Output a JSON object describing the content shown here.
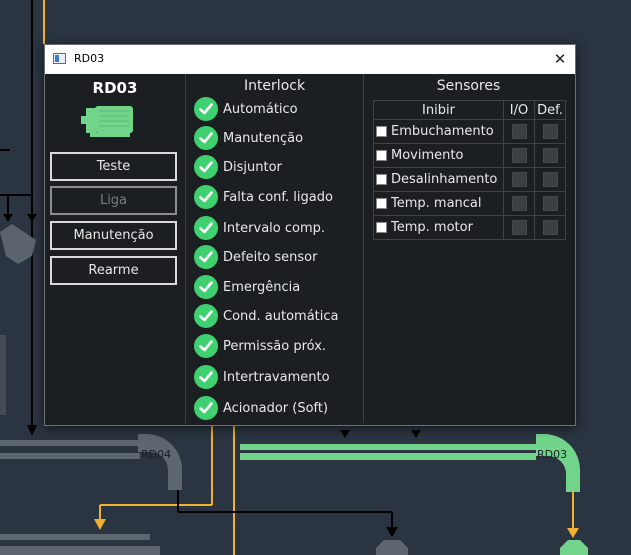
{
  "window": {
    "title": "RD03"
  },
  "device": {
    "name": "RD03",
    "motor_icon": "motor-icon",
    "motor_color": "#72d48a"
  },
  "buttons": {
    "teste": "Teste",
    "liga": "Liga",
    "manutencao": "Manutenção",
    "rearme": "Rearme"
  },
  "interlock": {
    "title": "Interlock",
    "items": [
      {
        "label": "Automático",
        "ok": true
      },
      {
        "label": "Manutenção",
        "ok": true
      },
      {
        "label": "Disjuntor",
        "ok": true
      },
      {
        "label": "Falta conf. ligado",
        "ok": true
      },
      {
        "label": "Intervalo comp.",
        "ok": true
      },
      {
        "label": "Defeito sensor",
        "ok": true
      },
      {
        "label": "Emergência",
        "ok": true
      },
      {
        "label": "Cond. automática",
        "ok": true
      },
      {
        "label": "Permissão próx.",
        "ok": true
      },
      {
        "label": "Intertravamento",
        "ok": true
      },
      {
        "label": "Acionador (Soft)",
        "ok": true
      }
    ]
  },
  "sensors": {
    "title": "Sensores",
    "headers": {
      "inhibit": "Inibir",
      "io": "I/O",
      "def": "Def."
    },
    "rows": [
      {
        "name": "Embuchamento",
        "inhibit": false
      },
      {
        "name": "Movimento",
        "inhibit": false
      },
      {
        "name": "Desalinhamento",
        "inhibit": false
      },
      {
        "name": "Temp. mancal",
        "inhibit": false
      },
      {
        "name": "Temp. motor",
        "inhibit": false
      }
    ]
  },
  "background": {
    "equipment_labels": {
      "left": "RD04",
      "right": "RD03"
    },
    "colors": {
      "bg": "#2b3441",
      "active": "#72d48a",
      "inactive": "#5e6670",
      "line_orange": "#f0b030"
    }
  }
}
